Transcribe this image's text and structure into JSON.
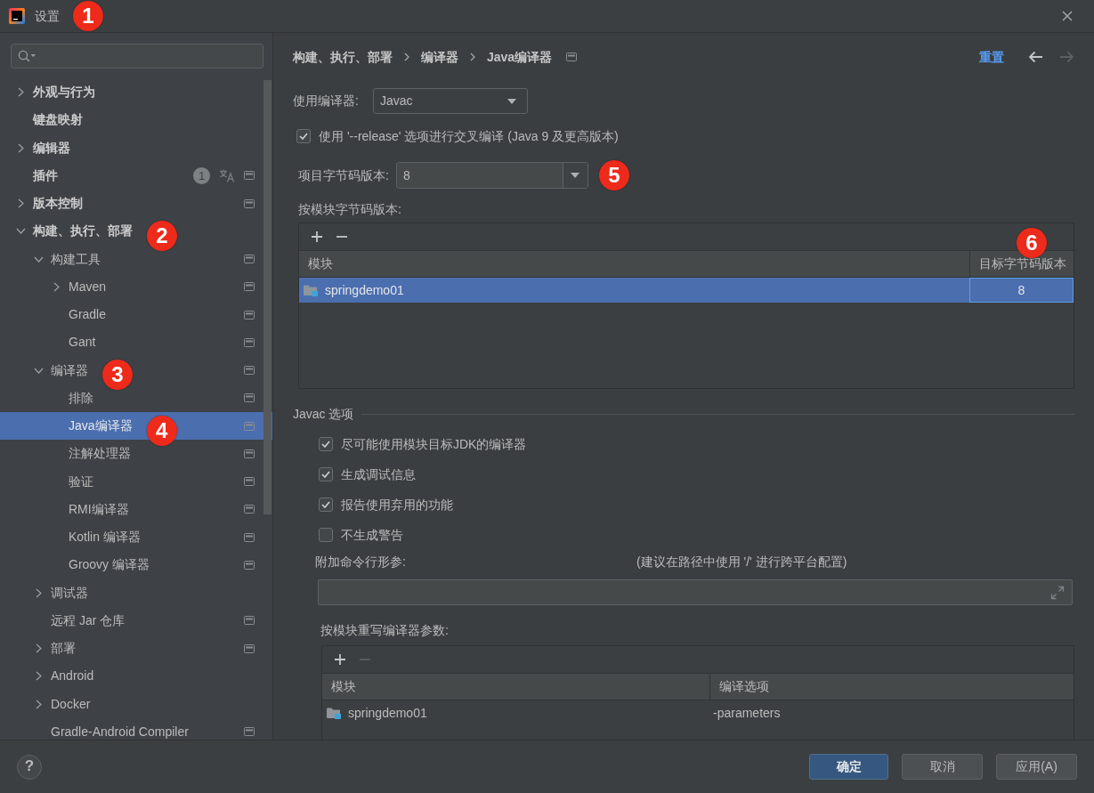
{
  "window": {
    "title": "设置",
    "marker": "1"
  },
  "sidebar": {
    "items": [
      {
        "label": "外观与行为",
        "kind": "group",
        "expanded": false,
        "project_level": false,
        "selected": false
      },
      {
        "label": "键盘映射",
        "kind": "page",
        "project_level": false,
        "selected": false
      },
      {
        "label": "编辑器",
        "kind": "group",
        "expanded": false,
        "project_level": false,
        "selected": false
      },
      {
        "label": "插件",
        "kind": "page",
        "project_level": true,
        "selected": false,
        "badge": "1",
        "language_pack": true
      },
      {
        "label": "版本控制",
        "kind": "group",
        "expanded": false,
        "project_level": true,
        "selected": false
      },
      {
        "label": "构建、执行、部署",
        "kind": "group",
        "expanded": true,
        "project_level": false,
        "selected": false,
        "marker": "2",
        "children": [
          {
            "label": "构建工具",
            "kind": "group",
            "expanded": true,
            "project_level": true,
            "selected": false,
            "children": [
              {
                "label": "Maven",
                "kind": "group",
                "expanded": false,
                "project_level": true,
                "selected": false
              },
              {
                "label": "Gradle",
                "kind": "page",
                "project_level": true,
                "selected": false
              },
              {
                "label": "Gant",
                "kind": "page",
                "project_level": true,
                "selected": false
              }
            ]
          },
          {
            "label": "编译器",
            "kind": "group",
            "expanded": true,
            "project_level": true,
            "selected": false,
            "marker": "3",
            "children": [
              {
                "label": "排除",
                "kind": "page",
                "project_level": true,
                "selected": false
              },
              {
                "label": "Java编译器",
                "kind": "page",
                "project_level": true,
                "selected": true,
                "marker": "4"
              },
              {
                "label": "注解处理器",
                "kind": "page",
                "project_level": true,
                "selected": false
              },
              {
                "label": "验证",
                "kind": "page",
                "project_level": true,
                "selected": false
              },
              {
                "label": "RMI编译器",
                "kind": "page",
                "project_level": true,
                "selected": false
              },
              {
                "label": "Kotlin 编译器",
                "kind": "page",
                "project_level": true,
                "selected": false
              },
              {
                "label": "Groovy 编译器",
                "kind": "page",
                "project_level": true,
                "selected": false
              }
            ]
          },
          {
            "label": "调试器",
            "kind": "group",
            "expanded": false,
            "project_level": false,
            "selected": false
          },
          {
            "label": "远程 Jar 仓库",
            "kind": "page",
            "project_level": true,
            "selected": false
          },
          {
            "label": "部署",
            "kind": "group",
            "expanded": false,
            "project_level": true,
            "selected": false
          },
          {
            "label": "Android",
            "kind": "group",
            "expanded": false,
            "project_level": false,
            "selected": false
          },
          {
            "label": "Docker",
            "kind": "group",
            "expanded": false,
            "project_level": false,
            "selected": false
          },
          {
            "label": "Gradle-Android Compiler",
            "kind": "page",
            "project_level": true,
            "selected": false
          }
        ]
      }
    ]
  },
  "content": {
    "breadcrumb": {
      "items": [
        "构建、执行、部署",
        "编译器",
        "Java编译器"
      ],
      "project_level": true,
      "reset": "重置",
      "back_enabled": true,
      "forward_enabled": false
    },
    "compiler": {
      "label": "使用编译器:",
      "value": "Javac"
    },
    "release_option": {
      "label": "使用 '--release' 选项进行交叉编译 (Java 9 及更高版本)",
      "checked": true
    },
    "bytecode_version": {
      "label": "项目字节码版本:",
      "value": "8",
      "marker": "5"
    },
    "module_bytecode": {
      "label": "按模块字节码版本:",
      "toolbar": [
        {
          "kind": "add",
          "disabled": false
        },
        {
          "kind": "remove",
          "disabled": false
        }
      ],
      "columns": [
        {
          "label": "模块"
        },
        {
          "label": "目标字节码版本",
          "marker": "6"
        }
      ],
      "rows": [
        {
          "module": "springdemo01",
          "target": "8",
          "selected": true,
          "editing": true
        }
      ]
    },
    "javac_options": {
      "title": "Javac 选项",
      "options": [
        {
          "label": "尽可能使用模块目标JDK的编译器",
          "checked": true
        },
        {
          "label": "生成调试信息",
          "checked": true
        },
        {
          "label": "报告使用弃用的功能",
          "checked": true
        },
        {
          "label": "不生成警告",
          "checked": false
        }
      ]
    },
    "additional_params": {
      "label": "附加命令行形参:",
      "note": "(建议在路径中使用 '/' 进行跨平台配置)"
    },
    "override_params": {
      "label": "按模块重写编译器参数:",
      "toolbar": [
        {
          "kind": "add",
          "disabled": false
        },
        {
          "kind": "remove",
          "disabled": true
        }
      ],
      "columns": [
        {
          "label": "模块"
        },
        {
          "label": "编译选项"
        }
      ],
      "rows": [
        {
          "module": "springdemo01",
          "options": "-parameters",
          "selected": false
        }
      ]
    }
  },
  "footer": {
    "help": "?",
    "buttons": [
      {
        "label": "确定",
        "kind": "ok"
      },
      {
        "label": "取消",
        "kind": "cancel"
      },
      {
        "label": "应用(A)",
        "kind": "apply"
      }
    ]
  }
}
